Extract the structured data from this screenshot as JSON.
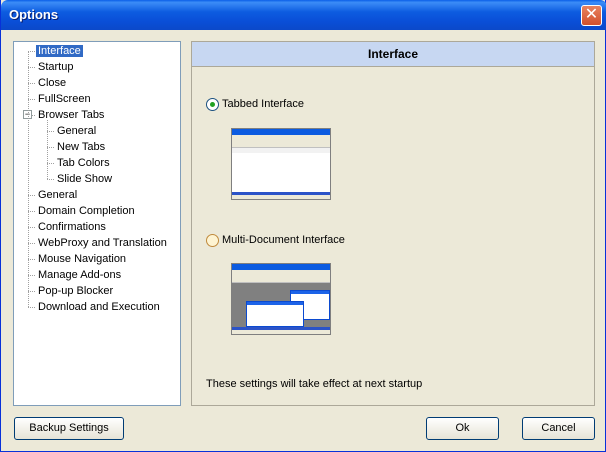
{
  "window": {
    "title": "Options",
    "close_glyph": "✕"
  },
  "tree": {
    "items": [
      {
        "label": "Interface",
        "selected": true
      },
      {
        "label": "Startup"
      },
      {
        "label": "Close"
      },
      {
        "label": "FullScreen"
      },
      {
        "label": "Browser Tabs",
        "expanded": true
      },
      {
        "label": "General",
        "child": true
      },
      {
        "label": "New Tabs",
        "child": true
      },
      {
        "label": "Tab Colors",
        "child": true
      },
      {
        "label": "Slide Show",
        "child": true
      },
      {
        "label": "General"
      },
      {
        "label": "Domain Completion"
      },
      {
        "label": "Confirmations"
      },
      {
        "label": "WebProxy and Translation"
      },
      {
        "label": "Mouse Navigation"
      },
      {
        "label": "Manage Add-ons"
      },
      {
        "label": "Pop-up Blocker"
      },
      {
        "label": "Download and Execution"
      }
    ],
    "expander_glyph": "−"
  },
  "panel": {
    "header": "Interface",
    "options": [
      {
        "label": "Tabbed Interface",
        "checked": true
      },
      {
        "label": "Multi-Document Interface",
        "checked": false
      }
    ],
    "note": "These settings will take effect at next startup"
  },
  "buttons": {
    "backup": "Backup Settings",
    "ok": "Ok",
    "cancel": "Cancel"
  },
  "colors": {
    "selection": "#316ac5",
    "header_bg": "#c7d7f2",
    "titlebar": "#0a5fe8"
  }
}
